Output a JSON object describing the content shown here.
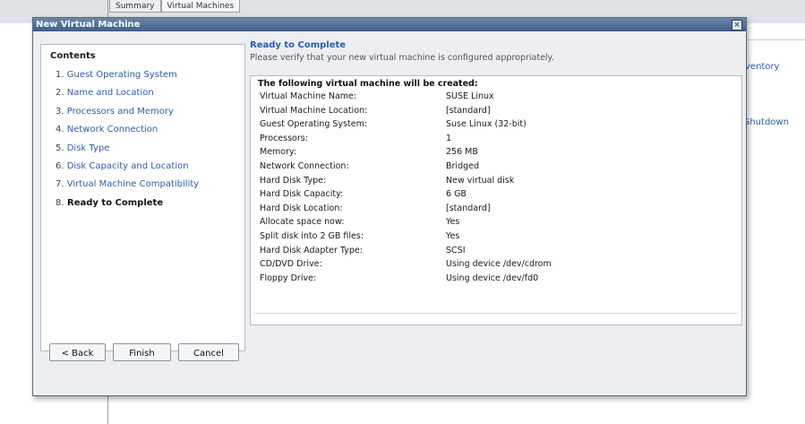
{
  "background": {
    "tabs": [
      "Summary",
      "Virtual Machines"
    ],
    "links": [
      "ventory",
      "Shutdown"
    ]
  },
  "dialog": {
    "title": "New Virtual Machine",
    "close_icon": "close-icon",
    "contents_title": "Contents",
    "steps": [
      {
        "num": "1.",
        "label": "Guest Operating System"
      },
      {
        "num": "2.",
        "label": "Name and Location"
      },
      {
        "num": "3.",
        "label": "Processors and Memory"
      },
      {
        "num": "4.",
        "label": "Network Connection"
      },
      {
        "num": "5.",
        "label": "Disk Type"
      },
      {
        "num": "6.",
        "label": "Disk Capacity and Location"
      },
      {
        "num": "7.",
        "label": "Virtual Machine Compatibility"
      },
      {
        "num": "8.",
        "label": "Ready to Complete"
      }
    ],
    "current_step": 8,
    "buttons": {
      "back": "< Back",
      "finish": "Finish",
      "cancel": "Cancel"
    },
    "heading": "Ready to Complete",
    "subheading": "Please verify that your new virtual machine is configured appropriately.",
    "summary_title": "The following virtual machine will be created:",
    "summary": [
      {
        "key": "Virtual Machine Name:",
        "value": "SUSE Linux"
      },
      {
        "key": "Virtual Machine Location:",
        "value": "[standard]"
      },
      {
        "key": "Guest Operating System:",
        "value": "Suse Linux (32-bit)"
      },
      {
        "key": "Processors:",
        "value": "1"
      },
      {
        "key": "Memory:",
        "value": "256 MB"
      },
      {
        "key": "Network Connection:",
        "value": "Bridged"
      },
      {
        "key": "Hard Disk Type:",
        "value": "New virtual disk"
      },
      {
        "key": "Hard Disk Capacity:",
        "value": "6 GB"
      },
      {
        "key": "Hard Disk Location:",
        "value": "[standard]"
      },
      {
        "key": "Allocate space now:",
        "value": "Yes"
      },
      {
        "key": "Split disk into 2 GB files:",
        "value": "Yes"
      },
      {
        "key": "Hard Disk Adapter Type:",
        "value": "SCSI"
      },
      {
        "key": "CD/DVD Drive:",
        "value": "Using device /dev/cdrom"
      },
      {
        "key": "Floppy Drive:",
        "value": "Using device /dev/fd0"
      }
    ]
  }
}
